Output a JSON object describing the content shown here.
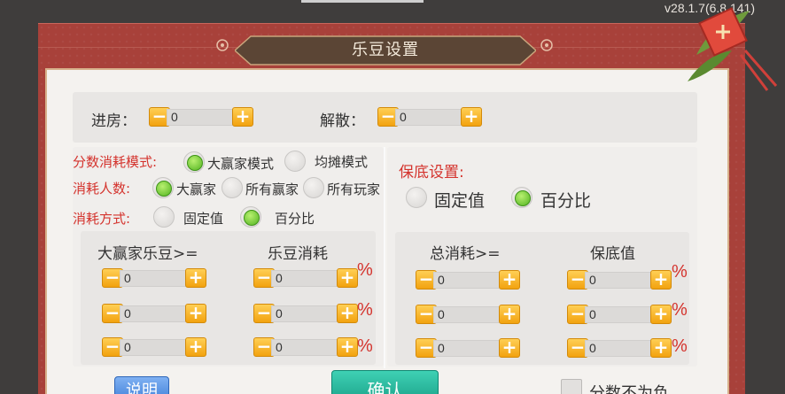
{
  "version": "v28.1.7(6.8.141)",
  "title": "乐豆设置",
  "room": {
    "enter_label": "进房：",
    "enter_value": "0",
    "dismiss_label": "解散：",
    "dismiss_value": "0"
  },
  "consume": {
    "mode_label": "分数消耗模式:",
    "mode_options": [
      "大赢家模式",
      "均摊模式"
    ],
    "mode_selected": "大赢家模式",
    "people_label": "消耗人数:",
    "people_options": [
      "大赢家",
      "所有赢家",
      "所有玩家"
    ],
    "people_selected": "大赢家",
    "method_label": "消耗方式:",
    "method_options": [
      "固定值",
      "百分比"
    ],
    "method_selected": "百分比",
    "col1_header": "大赢家乐豆>=",
    "col2_header": "乐豆消耗",
    "rows": [
      {
        "threshold": "0",
        "cost": "0",
        "unit": "%"
      },
      {
        "threshold": "0",
        "cost": "0",
        "unit": "%"
      },
      {
        "threshold": "0",
        "cost": "0",
        "unit": "%"
      }
    ]
  },
  "guarantee": {
    "label": "保底设置:",
    "options": [
      "固定值",
      "百分比"
    ],
    "selected": "百分比",
    "col1_header": "总消耗>=",
    "col2_header": "保底值",
    "rows": [
      {
        "threshold": "0",
        "value": "0",
        "unit": "%"
      },
      {
        "threshold": "0",
        "value": "0",
        "unit": "%"
      },
      {
        "threshold": "0",
        "value": "0",
        "unit": "%"
      }
    ]
  },
  "footer": {
    "help_label": "说明",
    "confirm_label": "确认",
    "no_negative_label": "分数不为负"
  },
  "colors": {
    "frame": "#a8413a",
    "accent_red": "#d4332d",
    "stepper": "#f2a20f",
    "radio_on": "#52b320",
    "confirm": "#189f86",
    "help": "#3f7fd8"
  }
}
